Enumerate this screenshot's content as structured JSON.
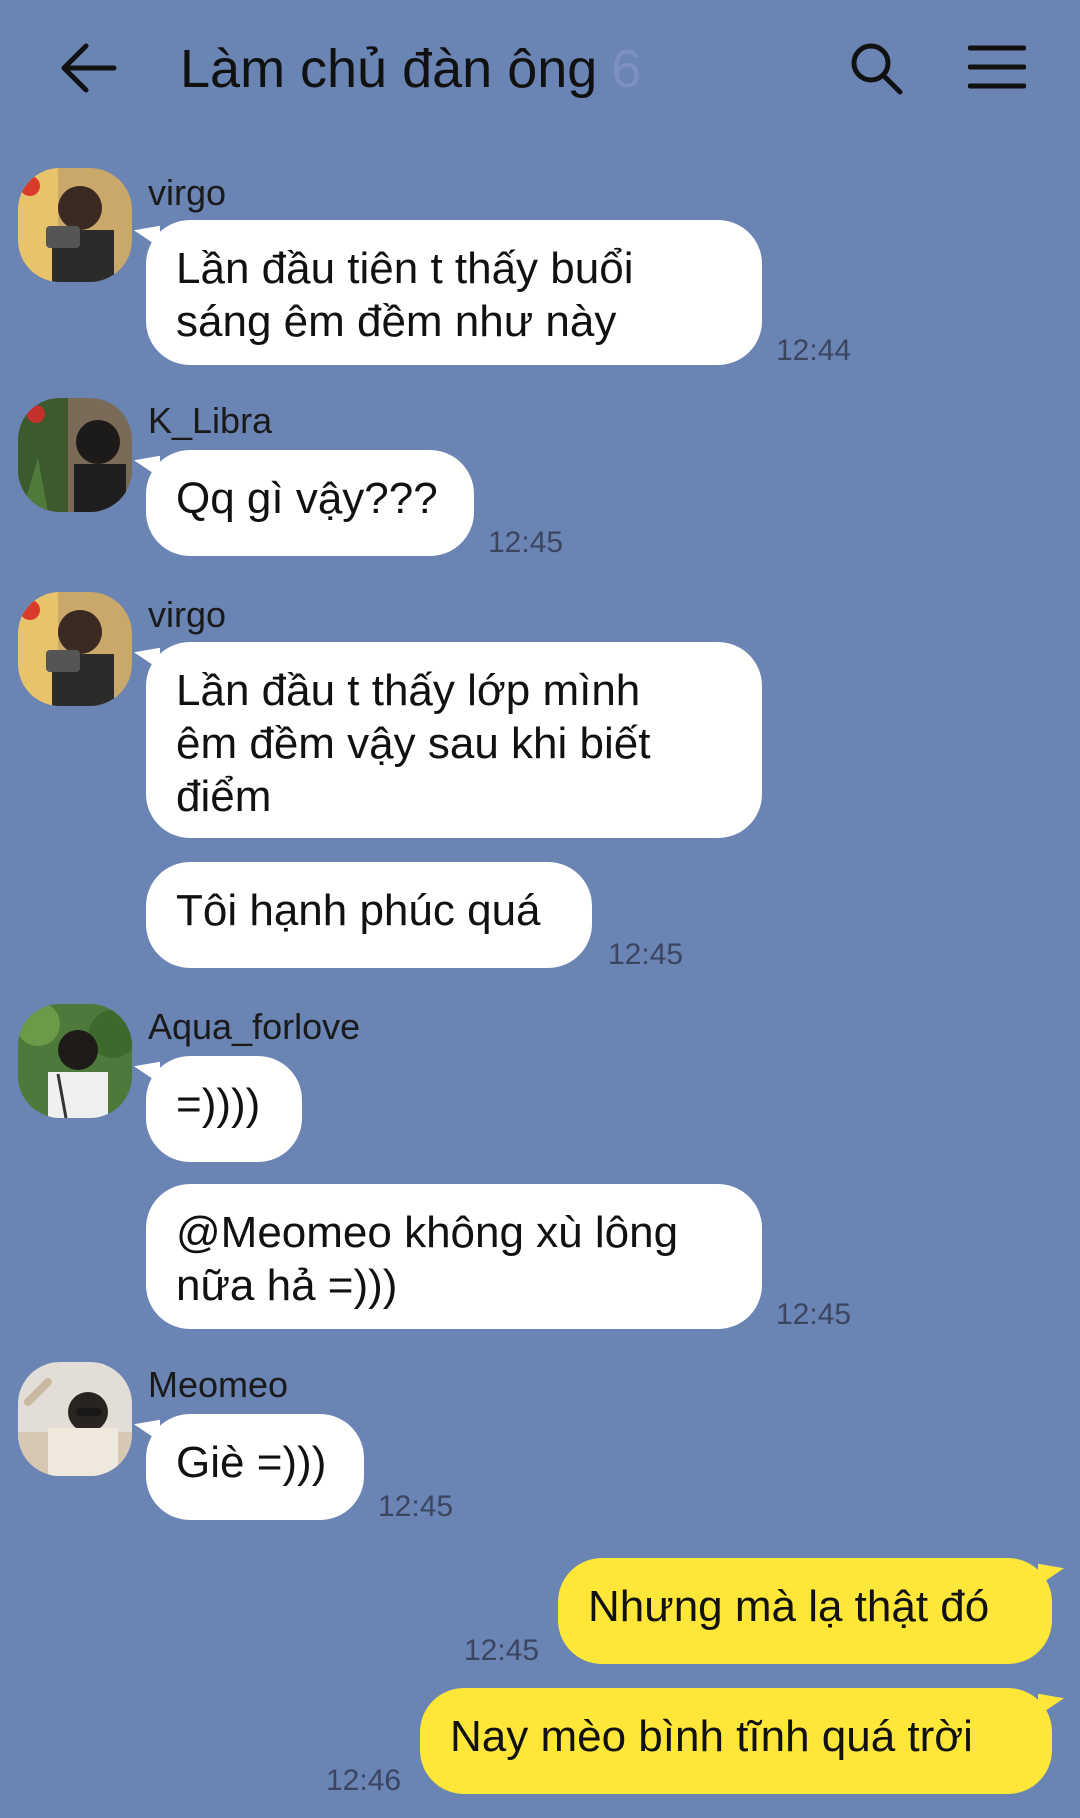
{
  "header": {
    "title": "Làm chủ đàn ông",
    "member_count": "6",
    "back_icon": "arrow-left-icon",
    "search_icon": "search-icon",
    "menu_icon": "hamburger-menu-icon"
  },
  "messages": [
    {
      "sender": "virgo",
      "lines": [
        "Lần đầu tiên t thấy buổi",
        "sáng êm đềm như này"
      ],
      "time": "12:44"
    },
    {
      "sender": "K_Libra",
      "lines": [
        "Qq gì vậy???"
      ],
      "time": "12:45"
    },
    {
      "sender": "virgo",
      "lines": [
        "Lần đầu t thấy lớp mình",
        "êm đềm vậy sau khi biết",
        "điểm"
      ]
    },
    {
      "lines": [
        "Tôi hạnh phúc quá"
      ],
      "time": "12:45"
    },
    {
      "sender": "Aqua_forlove",
      "lines": [
        "=))))"
      ]
    },
    {
      "lines": [
        "@Meomeo không xù lông",
        "nữa hả =)))"
      ],
      "time": "12:45"
    },
    {
      "sender": "Meomeo",
      "lines": [
        "Giè =)))"
      ],
      "time": "12:45"
    },
    {
      "lines": [
        "Nhưng mà lạ thật đó"
      ],
      "time": "12:45",
      "mine": true
    },
    {
      "lines": [
        "Nay mèo bình tĩnh quá trời"
      ],
      "time": "12:46",
      "mine": true
    }
  ],
  "colors": {
    "background": "#6a84b4",
    "incoming_bubble": "#ffffff",
    "outgoing_bubble": "#ffe739"
  }
}
